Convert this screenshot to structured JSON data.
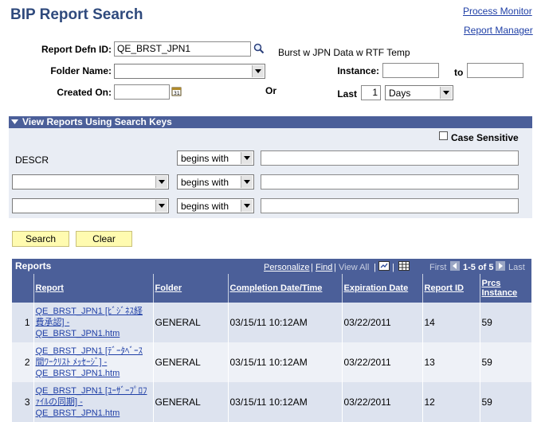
{
  "page_title": "BIP Report Search",
  "links": {
    "process_monitor": "Process Monitor",
    "report_manager": "Report Manager"
  },
  "criteria": {
    "report_defn_label": "Report Defn ID:",
    "report_defn_value": "QE_BRST_JPN1",
    "report_defn_desc": "Burst w JPN Data w RTF Temp",
    "folder_label": "Folder Name:",
    "folder_value": "",
    "created_on_label": "Created On:",
    "created_on_value": "",
    "or_label": "Or",
    "instance_label": "Instance:",
    "instance_from": "",
    "to_label": "to",
    "instance_to": "",
    "last_label": "Last",
    "last_value": "1",
    "last_unit": "Days"
  },
  "search_keys": {
    "title": "View Reports Using Search Keys",
    "case_sensitive_label": "Case Sensitive",
    "rows": [
      {
        "field": "DESCR",
        "operator": "begins with",
        "value": ""
      },
      {
        "field": "",
        "operator": "begins with",
        "value": ""
      },
      {
        "field": "",
        "operator": "begins with",
        "value": ""
      }
    ]
  },
  "buttons": {
    "search": "Search",
    "clear": "Clear"
  },
  "grid": {
    "title": "Reports",
    "personalize": "Personalize",
    "sep1": "|",
    "find": "Find",
    "sep2": "|",
    "view_all": "View All",
    "sep3": "|",
    "first": "First",
    "range": "1-5 of 5",
    "last": "Last",
    "columns": [
      "Report",
      "Folder",
      "Completion Date/Time",
      "Expiration Date",
      "Report ID",
      "Prcs Instance"
    ],
    "rows": [
      {
        "n": "1",
        "report": "QE_BRST_JPN1 [ﾋﾞｼﾞﾈｽ経費承認] - QE_BRST_JPN1.htm",
        "folder": "GENERAL",
        "completion": "03/15/11 10:12AM",
        "expiration": "03/22/2011",
        "report_id": "14",
        "prcs": "59"
      },
      {
        "n": "2",
        "report": "QE_BRST_JPN1 [ﾃﾞｰﾀﾍﾞｰｽ間ﾜｰｸﾘｽﾄ ﾒｯｾｰｼﾞ] - QE_BRST_JPN1.htm",
        "folder": "GENERAL",
        "completion": "03/15/11 10:12AM",
        "expiration": "03/22/2011",
        "report_id": "13",
        "prcs": "59"
      },
      {
        "n": "3",
        "report": "QE_BRST_JPN1 [ﾕｰｻﾞｰﾌﾟﾛﾌｧｲﾙの同期] - QE_BRST_JPN1.htm",
        "folder": "GENERAL",
        "completion": "03/15/11 10:12AM",
        "expiration": "03/22/2011",
        "report_id": "12",
        "prcs": "59"
      }
    ]
  }
}
